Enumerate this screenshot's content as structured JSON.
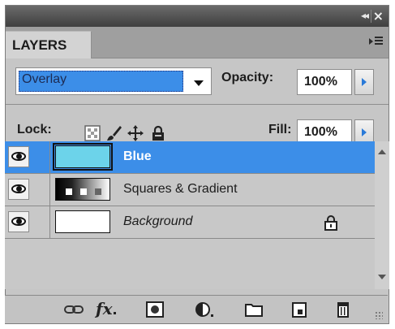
{
  "panel": {
    "title": "LAYERS"
  },
  "blend_mode": {
    "value": "Overlay"
  },
  "opacity": {
    "label": "Opacity:",
    "value": "100%"
  },
  "lock": {
    "label": "Lock:",
    "icons": [
      "lock-transparent-pixels-icon",
      "lock-image-pixels-icon",
      "lock-position-icon",
      "lock-all-icon"
    ]
  },
  "fill": {
    "label": "Fill:",
    "value": "100%"
  },
  "layers": [
    {
      "name": "Blue",
      "selected": true,
      "italic": false,
      "locked": false,
      "thumb_color": "#6cd3ea"
    },
    {
      "name": "Squares & Gradient",
      "selected": false,
      "italic": false,
      "locked": false,
      "thumb_color": "gradient"
    },
    {
      "name": "Background",
      "selected": false,
      "italic": true,
      "locked": true,
      "thumb_color": "#ffffff"
    }
  ],
  "bottom_icons": [
    "link-layers-icon",
    "fx-icon",
    "layer-mask-icon",
    "adjustment-layer-icon",
    "new-group-icon",
    "new-layer-icon",
    "trash-icon"
  ],
  "bottom_fx_text": "fx",
  "colors": {
    "accent": "#3c8ee8",
    "panel_bg": "#c6c6c6"
  }
}
